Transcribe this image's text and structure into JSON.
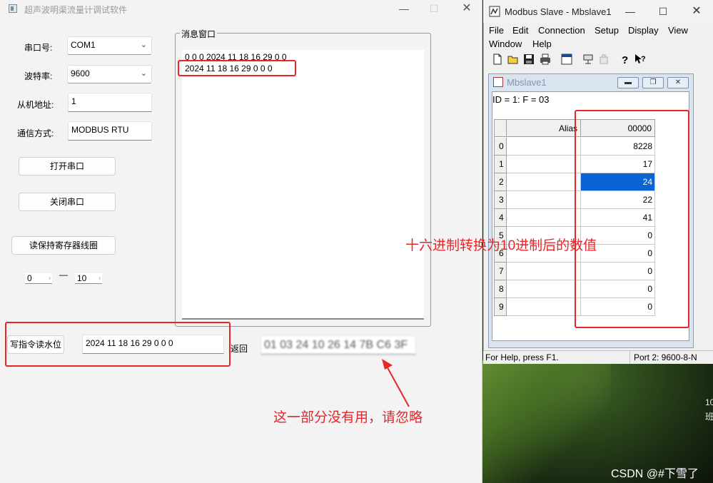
{
  "left_app": {
    "title": "超声波明渠流量计调试软件",
    "labels": {
      "serial_port": "串口号:",
      "baud_rate": "波特率:",
      "slave_addr": "从机地址:",
      "comm_mode": "通信方式:"
    },
    "serial_port_value": "COM1",
    "baud_rate_value": "9600",
    "slave_addr_value": "1",
    "comm_mode_value": "MODBUS RTU",
    "btn_open": "打开串口",
    "btn_close": "关闭串口",
    "btn_read": "读保持寄存器线圈",
    "range_from": "0",
    "range_sep": "—",
    "range_to": "10",
    "msg_group_title": "消息窗口",
    "messages": [
      "0 0 0 2024 11 18 16 29 0 0",
      "2024 11 18 16 29 0 0 0"
    ],
    "btn_write": "写指令读水位",
    "write_value": "2024 11 18 16 29 0 0 0",
    "return_label": "返回",
    "return_value": "01 03 24 10 26 14 7B C6 3F"
  },
  "annotations": {
    "hex_note": "十六进制转换为10进制后的数值",
    "ignore_note": "这一部分没有用，请忽略"
  },
  "modbus": {
    "title": "Modbus Slave - Mbslave1",
    "menu": [
      "File",
      "Edit",
      "Connection",
      "Setup",
      "Display",
      "View",
      "Window",
      "Help"
    ],
    "child_title": "Mbslave1",
    "id_line": "ID = 1: F = 03",
    "col_alias": "Alias",
    "col_addr": "00000",
    "rows": [
      {
        "index": "0",
        "value": "8228"
      },
      {
        "index": "1",
        "value": "17"
      },
      {
        "index": "2",
        "value": "24"
      },
      {
        "index": "3",
        "value": "22"
      },
      {
        "index": "4",
        "value": "41"
      },
      {
        "index": "5",
        "value": "0"
      },
      {
        "index": "6",
        "value": "0"
      },
      {
        "index": "7",
        "value": "0"
      },
      {
        "index": "8",
        "value": "0"
      },
      {
        "index": "9",
        "value": "0"
      }
    ],
    "selected_row": 2,
    "status_left": "For Help, press F1.",
    "status_right": "Port 2: 9600-8-N"
  },
  "desktop": {
    "side_text_1": "10",
    "side_text_2": "班",
    "watermark": "CSDN @#下雪了"
  },
  "colors": {
    "annotation_red": "#e8262a",
    "selection_blue": "#0a64d6"
  }
}
